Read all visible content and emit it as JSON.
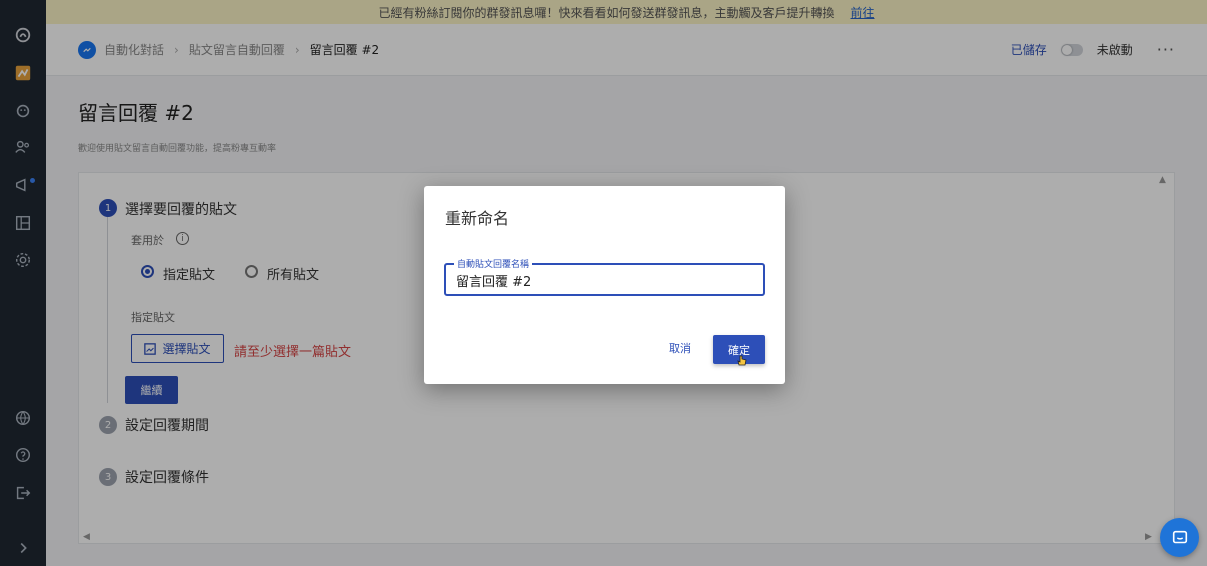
{
  "banner": {
    "text": "已經有粉絲訂閱你的群發訊息囉！快來看看如何發送群發訊息，主動觸及客戶提升轉換",
    "link": "前往"
  },
  "header": {
    "breadcrumb": [
      "自動化對話",
      "貼文留言自動回覆",
      "留言回覆 #2"
    ],
    "saved": "已儲存",
    "status": "未啟動",
    "more": "···"
  },
  "page": {
    "title": "留言回覆 #2",
    "description": "歡迎使用貼文留言自動回覆功能，提高粉專互動率"
  },
  "steps": [
    {
      "num": "1",
      "title": "選擇要回覆的貼文"
    },
    {
      "num": "2",
      "title": "設定回覆期間"
    },
    {
      "num": "3",
      "title": "設定回覆條件"
    }
  ],
  "step1": {
    "apply_label": "套用於",
    "radio_specific": "指定貼文",
    "radio_all": "所有貼文",
    "specific_label": "指定貼文",
    "choose_button": "選擇貼文",
    "error": "請至少選擇一篇貼文",
    "next_button": "繼續"
  },
  "dialog": {
    "title": "重新命名",
    "field_label": "自動貼文回覆名稱",
    "field_value": "留言回覆 #2",
    "cancel": "取消",
    "confirm": "確定"
  },
  "colors": {
    "primary": "#2d4fb8",
    "sidebar": "#1f2933",
    "error": "#d64545",
    "banner": "#fbf3c6"
  }
}
